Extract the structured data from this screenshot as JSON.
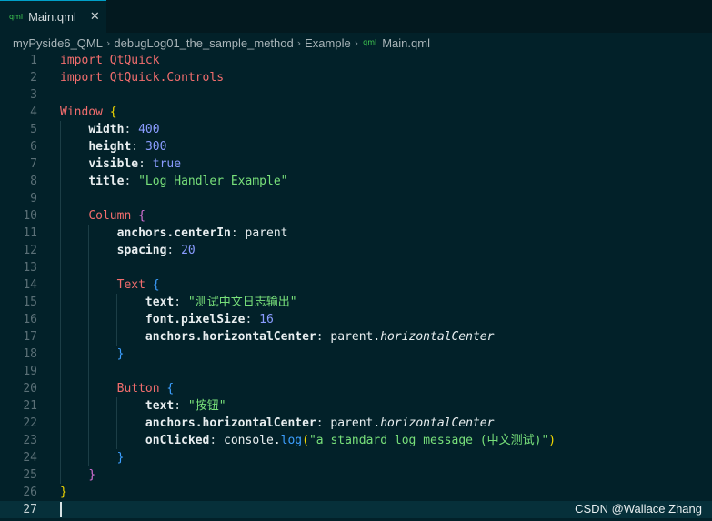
{
  "tab": {
    "icon": "qml",
    "label": "Main.qml",
    "close": "✕"
  },
  "breadcrumb": [
    {
      "label": "myPyside6_QML"
    },
    {
      "label": "debugLog01_the_sample_method"
    },
    {
      "label": "Example"
    },
    {
      "label": "Main.qml",
      "icon": "qml"
    }
  ],
  "editor": {
    "current_line": 27,
    "lines": [
      {
        "n": 1,
        "tokens": [
          [
            "kw",
            "import"
          ],
          [
            "punc",
            " "
          ],
          [
            "type",
            "QtQuick"
          ]
        ]
      },
      {
        "n": 2,
        "tokens": [
          [
            "kw",
            "import"
          ],
          [
            "punc",
            " "
          ],
          [
            "type",
            "QtQuick.Controls"
          ]
        ]
      },
      {
        "n": 3,
        "tokens": []
      },
      {
        "n": 4,
        "tokens": [
          [
            "type",
            "Window"
          ],
          [
            "punc",
            " "
          ],
          [
            "brace1",
            "{"
          ]
        ]
      },
      {
        "n": 5,
        "tokens": [
          [
            "punc",
            "    "
          ],
          [
            "prop",
            "width"
          ],
          [
            "punc",
            ": "
          ],
          [
            "num",
            "400"
          ]
        ]
      },
      {
        "n": 6,
        "tokens": [
          [
            "punc",
            "    "
          ],
          [
            "prop",
            "height"
          ],
          [
            "punc",
            ": "
          ],
          [
            "num",
            "300"
          ]
        ]
      },
      {
        "n": 7,
        "tokens": [
          [
            "punc",
            "    "
          ],
          [
            "prop",
            "visible"
          ],
          [
            "punc",
            ": "
          ],
          [
            "bool",
            "true"
          ]
        ]
      },
      {
        "n": 8,
        "tokens": [
          [
            "punc",
            "    "
          ],
          [
            "prop",
            "title"
          ],
          [
            "punc",
            ": "
          ],
          [
            "str",
            "\"Log Handler Example\""
          ]
        ]
      },
      {
        "n": 9,
        "tokens": []
      },
      {
        "n": 10,
        "tokens": [
          [
            "punc",
            "    "
          ],
          [
            "type",
            "Column"
          ],
          [
            "punc",
            " "
          ],
          [
            "brace2",
            "{"
          ]
        ]
      },
      {
        "n": 11,
        "tokens": [
          [
            "punc",
            "        "
          ],
          [
            "prop",
            "anchors.centerIn"
          ],
          [
            "punc",
            ": "
          ],
          [
            "id",
            "parent"
          ]
        ]
      },
      {
        "n": 12,
        "tokens": [
          [
            "punc",
            "        "
          ],
          [
            "prop",
            "spacing"
          ],
          [
            "punc",
            ": "
          ],
          [
            "num",
            "20"
          ]
        ]
      },
      {
        "n": 13,
        "tokens": []
      },
      {
        "n": 14,
        "tokens": [
          [
            "punc",
            "        "
          ],
          [
            "type",
            "Text"
          ],
          [
            "punc",
            " "
          ],
          [
            "brace3",
            "{"
          ]
        ]
      },
      {
        "n": 15,
        "tokens": [
          [
            "punc",
            "            "
          ],
          [
            "prop",
            "text"
          ],
          [
            "punc",
            ": "
          ],
          [
            "str",
            "\"测试中文日志输出\""
          ]
        ]
      },
      {
        "n": 16,
        "tokens": [
          [
            "punc",
            "            "
          ],
          [
            "prop",
            "font.pixelSize"
          ],
          [
            "punc",
            ": "
          ],
          [
            "num",
            "16"
          ]
        ]
      },
      {
        "n": 17,
        "tokens": [
          [
            "punc",
            "            "
          ],
          [
            "prop",
            "anchors.horizontalCenter"
          ],
          [
            "punc",
            ": "
          ],
          [
            "id",
            "parent."
          ],
          [
            "ital",
            "horizontalCenter"
          ]
        ]
      },
      {
        "n": 18,
        "tokens": [
          [
            "punc",
            "        "
          ],
          [
            "brace3",
            "}"
          ]
        ]
      },
      {
        "n": 19,
        "tokens": []
      },
      {
        "n": 20,
        "tokens": [
          [
            "punc",
            "        "
          ],
          [
            "type",
            "Button"
          ],
          [
            "punc",
            " "
          ],
          [
            "brace3",
            "{"
          ]
        ]
      },
      {
        "n": 21,
        "tokens": [
          [
            "punc",
            "            "
          ],
          [
            "prop",
            "text"
          ],
          [
            "punc",
            ": "
          ],
          [
            "str",
            "\"按钮\""
          ]
        ]
      },
      {
        "n": 22,
        "tokens": [
          [
            "punc",
            "            "
          ],
          [
            "prop",
            "anchors.horizontalCenter"
          ],
          [
            "punc",
            ": "
          ],
          [
            "id",
            "parent."
          ],
          [
            "ital",
            "horizontalCenter"
          ]
        ]
      },
      {
        "n": 23,
        "tokens": [
          [
            "punc",
            "            "
          ],
          [
            "prop",
            "onClicked"
          ],
          [
            "punc",
            ": "
          ],
          [
            "id",
            "console."
          ],
          [
            "func",
            "log"
          ],
          [
            "brace1",
            "("
          ],
          [
            "str",
            "\"a standard log message (中文测试)\""
          ],
          [
            "brace1",
            ")"
          ]
        ]
      },
      {
        "n": 24,
        "tokens": [
          [
            "punc",
            "        "
          ],
          [
            "brace3",
            "}"
          ]
        ]
      },
      {
        "n": 25,
        "tokens": [
          [
            "punc",
            "    "
          ],
          [
            "brace2",
            "}"
          ]
        ]
      },
      {
        "n": 26,
        "tokens": [
          [
            "brace1",
            "}"
          ]
        ]
      },
      {
        "n": 27,
        "tokens": []
      }
    ]
  },
  "watermark": "CSDN @Wallace Zhang",
  "colors": {
    "background": "#022129",
    "tab_accent": "#00a0c8",
    "keyword": "#f26d6d",
    "string": "#78e07a",
    "number": "#8a9cff"
  }
}
